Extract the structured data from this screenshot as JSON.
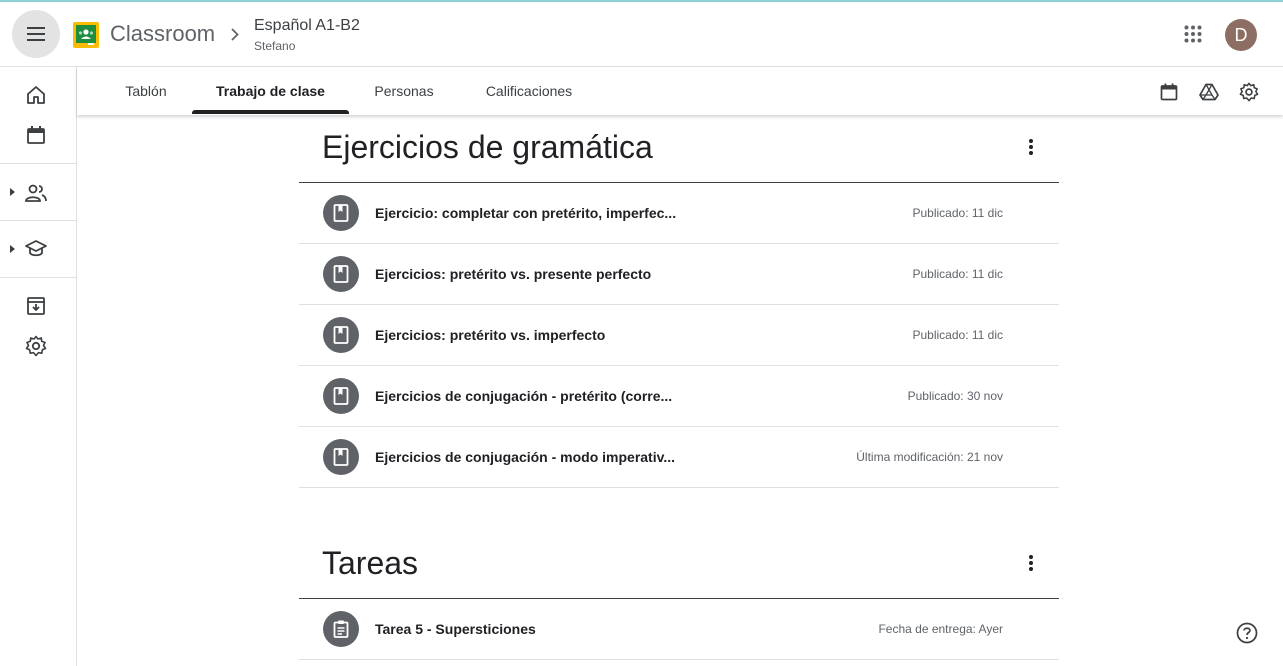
{
  "header": {
    "app_title": "Classroom",
    "class_name": "Español A1-B2",
    "class_section": "Stefano",
    "avatar_initial": "D"
  },
  "tabs": [
    {
      "label": "Tablón"
    },
    {
      "label": "Trabajo de clase",
      "active": true
    },
    {
      "label": "Personas"
    },
    {
      "label": "Calificaciones"
    }
  ],
  "topics": [
    {
      "title": "Ejercicios de gramática",
      "items": [
        {
          "title": "Ejercicio: completar con pretérito, imperfec...",
          "meta": "Publicado: 11 dic",
          "icon": "material-icon"
        },
        {
          "title": "Ejercicios: pretérito vs. presente perfecto",
          "meta": "Publicado: 11 dic",
          "icon": "material-icon"
        },
        {
          "title": "Ejercicios: pretérito vs. imperfecto",
          "meta": "Publicado: 11 dic",
          "icon": "material-icon"
        },
        {
          "title": "Ejercicios de conjugación - pretérito (corre...",
          "meta": "Publicado: 30 nov",
          "icon": "material-icon"
        },
        {
          "title": "Ejercicios de conjugación - modo imperativ...",
          "meta": "Última modificación: 21 nov",
          "icon": "material-icon"
        }
      ]
    },
    {
      "title": "Tareas",
      "items": [
        {
          "title": "Tarea 5 - Supersticiones",
          "meta": "Fecha de entrega: Ayer",
          "icon": "assignment-icon"
        }
      ]
    }
  ],
  "colors": {
    "accent": "#202124",
    "icon_circle": "#5f6368",
    "avatar": "#8d6e63",
    "logo_green": "#1e8e3e",
    "logo_yellow": "#fbbc04"
  }
}
